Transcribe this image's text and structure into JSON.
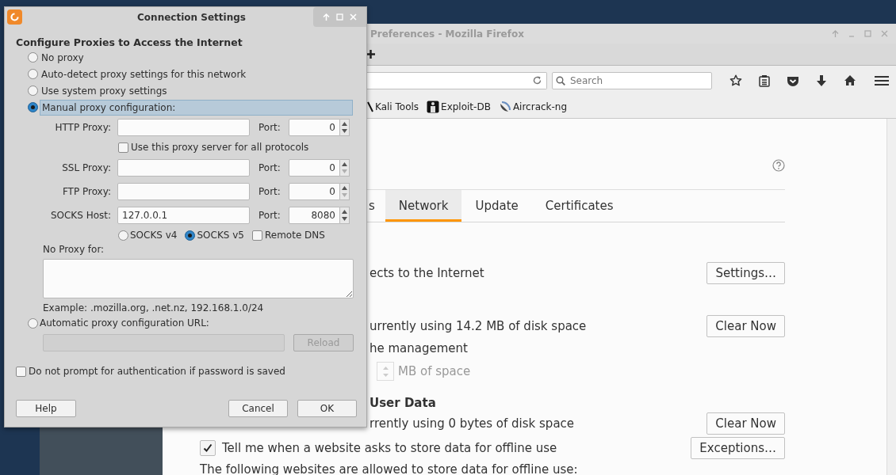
{
  "browser": {
    "title": "Preferences - Mozilla Firefox",
    "search": {
      "placeholder": "Search"
    },
    "bookmarks": [
      {
        "label": "Kali Tools",
        "kind": "tool"
      },
      {
        "label": "Exploit-DB",
        "kind": "db"
      },
      {
        "label": "Aircrack-ng",
        "kind": "dish"
      }
    ],
    "pref_tabs": [
      {
        "label": "s",
        "selected": false
      },
      {
        "label": "Network",
        "selected": true
      },
      {
        "label": "Update",
        "selected": false
      },
      {
        "label": "Certificates",
        "selected": false
      }
    ],
    "rows": [
      {
        "kind": "text_button",
        "text": "ects to the Internet",
        "button": "Settings…"
      },
      {
        "kind": "text_button",
        "text": "urrently using 14.2 MB of disk space",
        "button": "Clear Now"
      },
      {
        "kind": "text",
        "text": "he management"
      },
      {
        "kind": "spinner",
        "text": "MB of space",
        "disabled": true
      },
      {
        "kind": "heading",
        "text": "User Data"
      },
      {
        "kind": "text_button",
        "text": "rrently using 0 bytes of disk space",
        "button": "Clear Now"
      },
      {
        "kind": "checkbox_button",
        "text": "Tell me when a website asks to store data for offline use",
        "checked": true,
        "button": "Exceptions…"
      },
      {
        "kind": "note",
        "text": "The following websites are allowed to store data for offline use:"
      }
    ]
  },
  "dialog": {
    "title": "Connection Settings",
    "heading": "Configure Proxies to Access the Internet",
    "modes": [
      {
        "label": "No proxy",
        "selected": false
      },
      {
        "label": "Auto-detect proxy settings for this network",
        "selected": false
      },
      {
        "label": "Use system proxy settings",
        "selected": false
      },
      {
        "label": "Manual proxy configuration:",
        "selected": true
      }
    ],
    "proxies": [
      {
        "label": "HTTP Proxy:",
        "port_label": "Port:",
        "port": "0",
        "down_disabled": false
      },
      {
        "label": "SSL Proxy:",
        "port_label": "Port:",
        "port": "0",
        "down_disabled": true
      },
      {
        "label": "FTP Proxy:",
        "port_label": "Port:",
        "port": "0",
        "down_disabled": true
      },
      {
        "label": "SOCKS Host:",
        "value": "127.0.0.1",
        "port_label": "Port:",
        "port": "8080",
        "down_disabled": false
      }
    ],
    "share_all": {
      "label": "Use this proxy server for all protocols",
      "checked": false
    },
    "socks_versions": [
      {
        "label": "SOCKS v4",
        "selected": false
      },
      {
        "label": "SOCKS v5",
        "selected": true
      }
    ],
    "remote_dns": {
      "label": "Remote DNS",
      "checked": false
    },
    "no_proxy_label": "No Proxy for:",
    "no_proxy_example": "Example: .mozilla.org, .net.nz, 192.168.1.0/24",
    "auto_url": {
      "label": "Automatic proxy configuration URL:",
      "selected": false,
      "button": "Reload",
      "disabled": true
    },
    "no_prompt": {
      "label": "Do not prompt for authentication if password is saved",
      "checked": false
    },
    "buttons": [
      "Help",
      "Cancel",
      "OK"
    ]
  }
}
